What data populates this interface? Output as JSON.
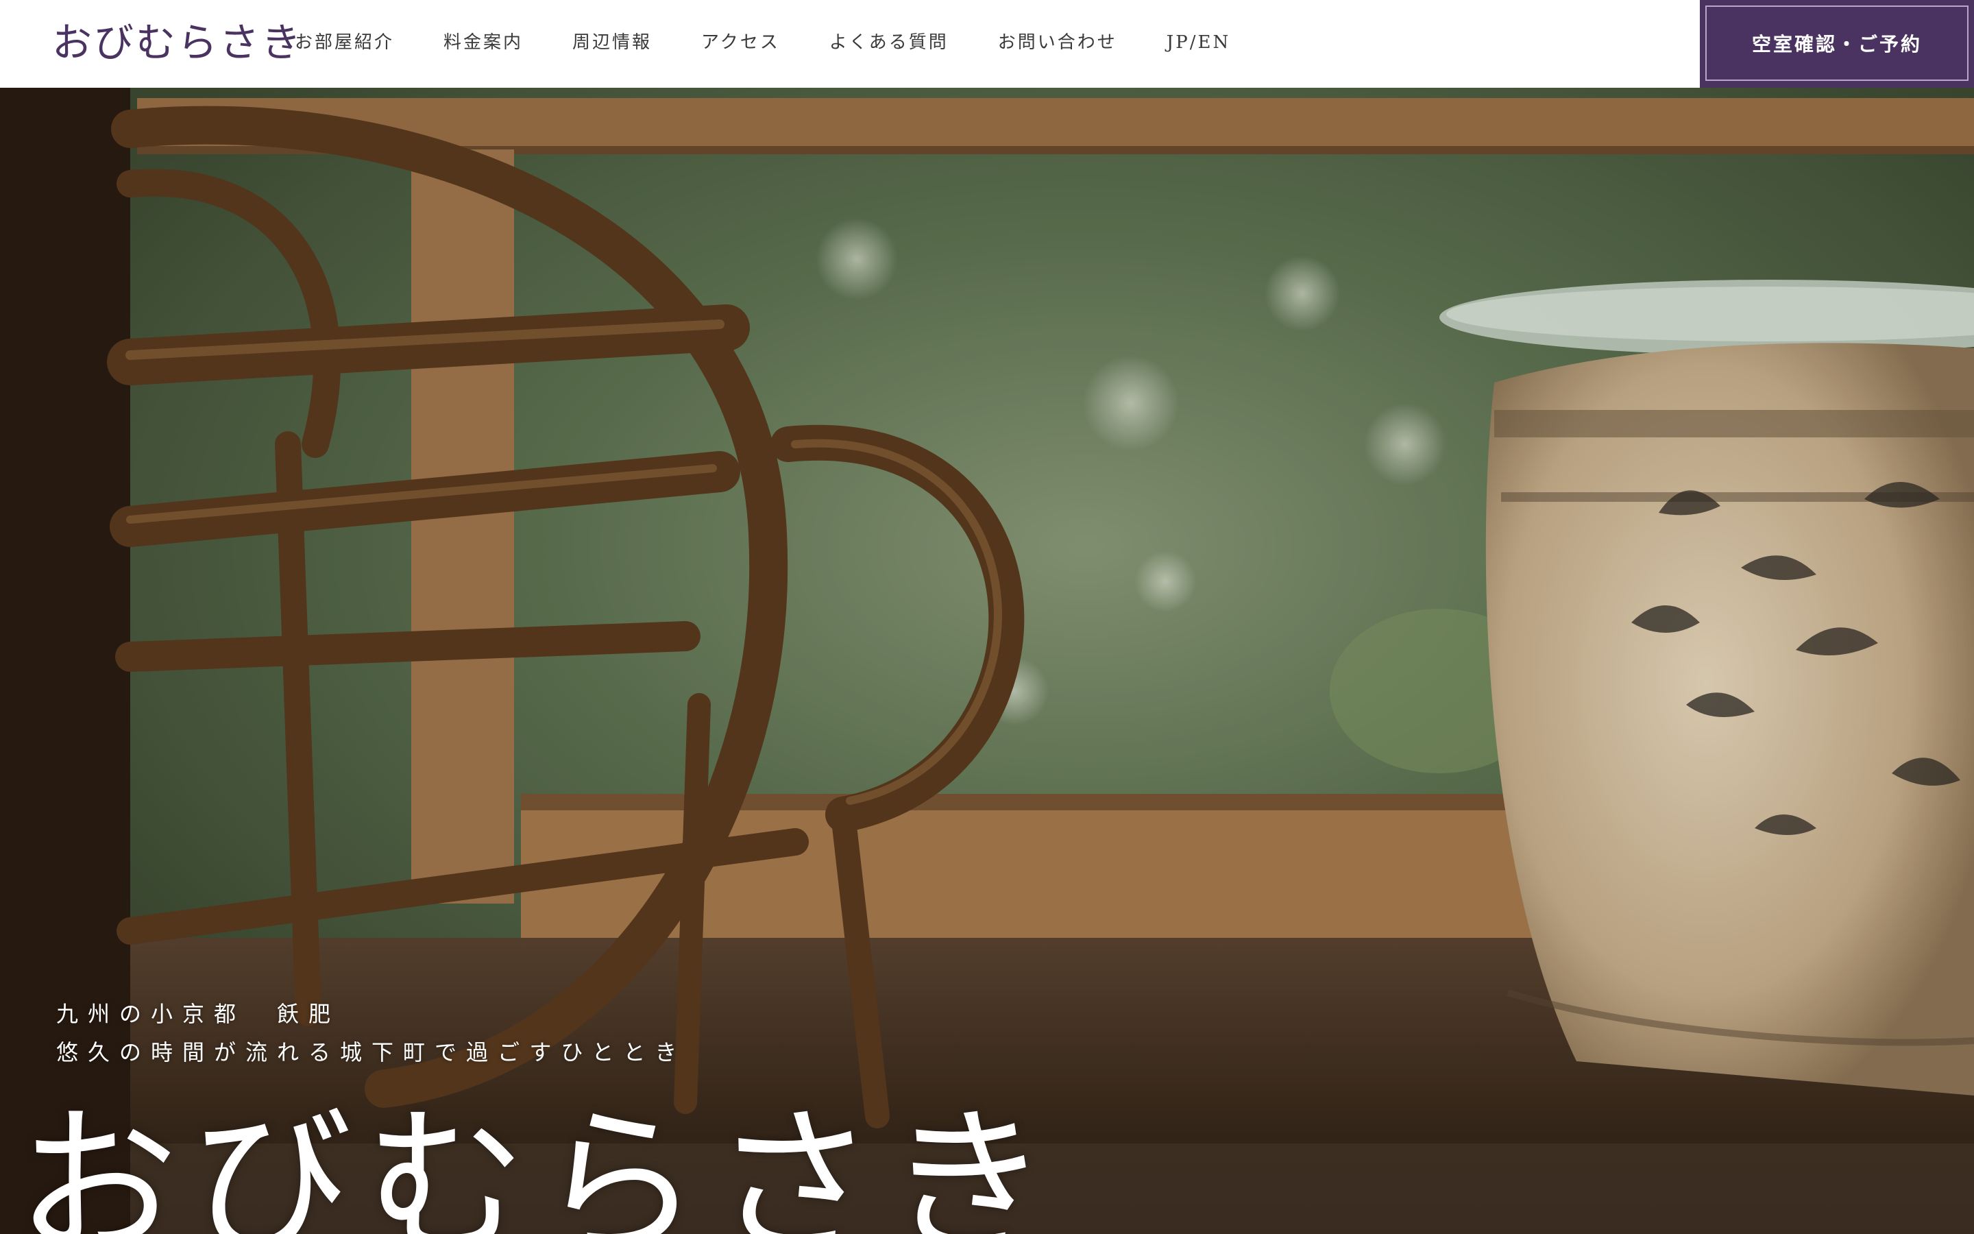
{
  "header": {
    "logo": "おびむらさき",
    "nav": [
      "お部屋紹介",
      "料金案内",
      "周辺情報",
      "アクセス",
      "よくある質問",
      "お問い合わせ",
      "JP/EN"
    ],
    "reserve_label": "空室確認・ご予約"
  },
  "hero": {
    "tagline_line1": "九州の小京都　飫肥",
    "tagline_line2": "悠久の時間が流れる城下町で過ごすひととき",
    "title": "おびむらさき"
  },
  "colors": {
    "brand_purple": "#4a3360",
    "header_bg": "#ffffff",
    "nav_text": "#3a3a3a"
  }
}
